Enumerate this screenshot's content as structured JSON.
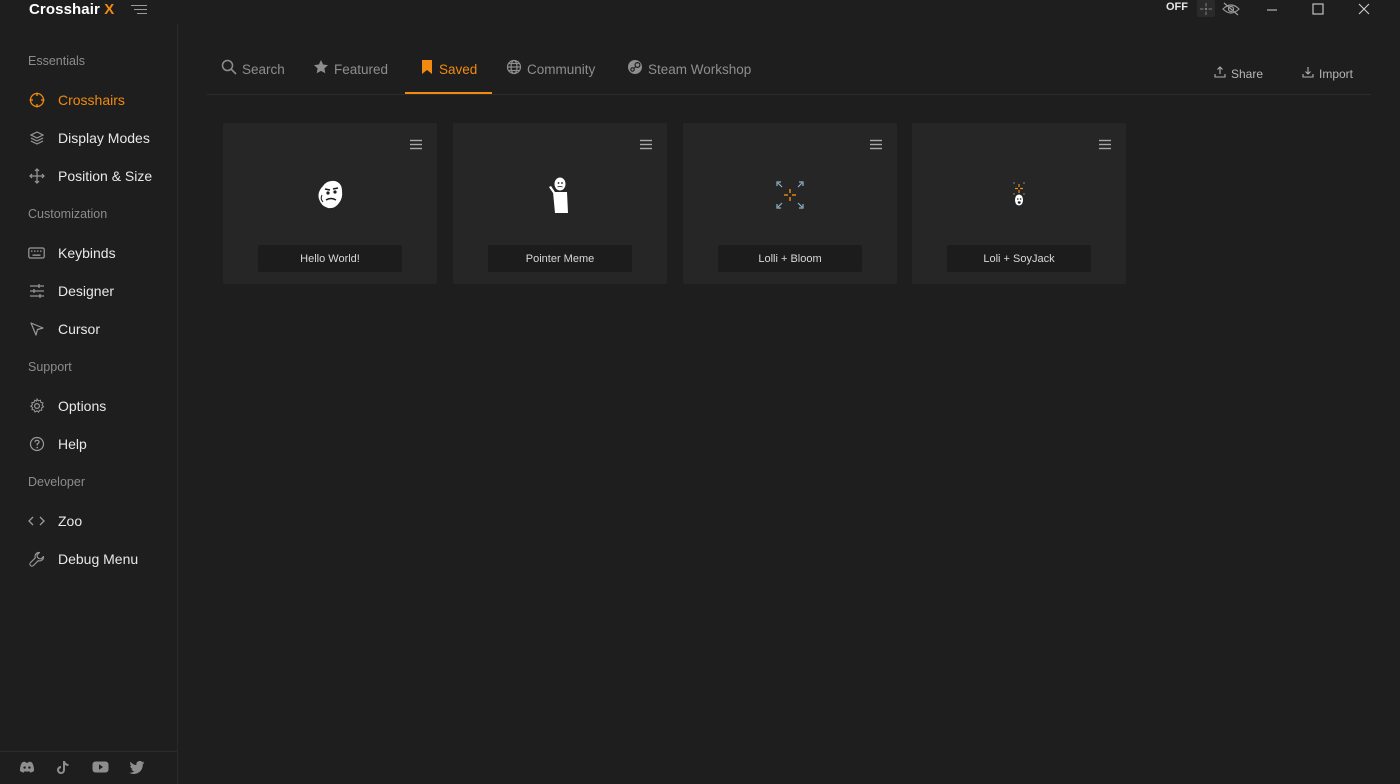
{
  "app": {
    "title_main": "Crosshair ",
    "title_accent": "X",
    "power_state": "OFF"
  },
  "sidebar": {
    "sections": [
      {
        "title": "Essentials"
      },
      {
        "title": "Customization"
      },
      {
        "title": "Support"
      },
      {
        "title": "Developer"
      }
    ],
    "items": [
      {
        "label": "Crosshairs",
        "icon": "crosshair-icon",
        "active": true
      },
      {
        "label": "Display Modes",
        "icon": "layers-icon"
      },
      {
        "label": "Position & Size",
        "icon": "move-icon"
      },
      {
        "label": "Keybinds",
        "icon": "keyboard-icon"
      },
      {
        "label": "Designer",
        "icon": "sliders-icon"
      },
      {
        "label": "Cursor",
        "icon": "cursor-icon"
      },
      {
        "label": "Options",
        "icon": "gear-icon"
      },
      {
        "label": "Help",
        "icon": "help-icon"
      },
      {
        "label": "Zoo",
        "icon": "code-icon"
      },
      {
        "label": "Debug Menu",
        "icon": "wrench-icon"
      }
    ],
    "social": [
      "discord-icon",
      "tiktok-icon",
      "youtube-icon",
      "twitter-icon"
    ]
  },
  "tabs": [
    {
      "label": "Search",
      "icon": "search-icon"
    },
    {
      "label": "Featured",
      "icon": "star-icon"
    },
    {
      "label": "Saved",
      "icon": "bookmark-icon",
      "active": true
    },
    {
      "label": "Community",
      "icon": "globe-icon"
    },
    {
      "label": "Steam Workshop",
      "icon": "steam-icon"
    }
  ],
  "actions": {
    "share": "Share",
    "import": "Import"
  },
  "cards": [
    {
      "name": "Hello World!"
    },
    {
      "name": "Pointer Meme"
    },
    {
      "name": "Lolli + Bloom"
    },
    {
      "name": "Loli + SoyJack"
    }
  ],
  "colors": {
    "accent": "#f28a0f",
    "background": "#1e1e1e",
    "card": "#262626"
  }
}
